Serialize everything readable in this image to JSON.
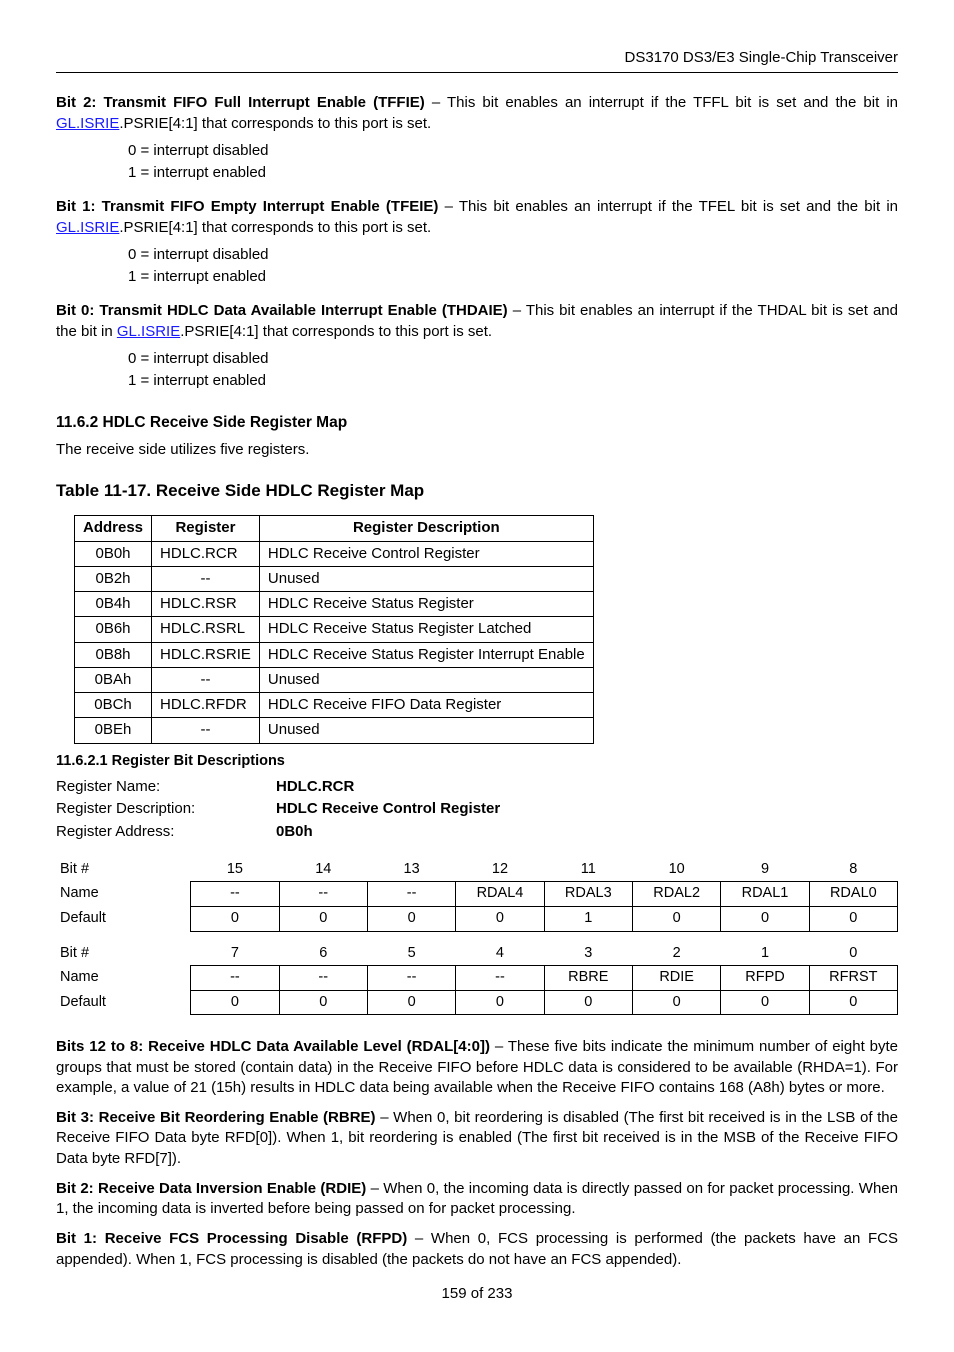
{
  "header": "DS3170 DS3/E3 Single-Chip Transceiver",
  "bit2": {
    "title": "Bit 2: Transmit FIFO Full Interrupt Enable (TFFIE)",
    "pre": " – This bit enables an interrupt if the TFFL bit is set and the bit in ",
    "link": "GL.ISRIE",
    "post": ".PSRIE[4:1] that corresponds to this port is set.",
    "l0": "0 = interrupt disabled",
    "l1": "1 = interrupt enabled"
  },
  "bit1": {
    "title": "Bit 1: Transmit FIFO Empty Interrupt Enable (TFEIE)",
    "pre": " – This bit enables an interrupt if the TFEL bit is set and the bit in ",
    "link": "GL.ISRIE",
    "post": ".PSRIE[4:1] that corresponds to this port is set.",
    "l0": "0 = interrupt disabled",
    "l1": "1 = interrupt enabled"
  },
  "bit0": {
    "title": "Bit 0: Transmit HDLC Data Available Interrupt Enable (THDAIE)",
    "pre": " – This bit enables an interrupt if the THDAL bit is set and the bit in ",
    "link": "GL.ISRIE",
    "post": ".PSRIE[4:1] that corresponds to this port is set.",
    "l0": "0 = interrupt disabled",
    "l1": "1 = interrupt enabled"
  },
  "section_1162": "11.6.2  HDLC Receive Side Register Map",
  "section_body": "The receive side utilizes five registers.",
  "table_title": "Table 11-17. Receive Side HDLC Register Map",
  "maphdr": {
    "a": "Address",
    "r": "Register",
    "d": "Register Description"
  },
  "rows": [
    {
      "a": "0B0h",
      "r": "HDLC.RCR",
      "d": "HDLC Receive Control Register"
    },
    {
      "a": "0B2h",
      "r": "--",
      "d": "Unused"
    },
    {
      "a": "0B4h",
      "r": "HDLC.RSR",
      "d": "HDLC Receive Status Register"
    },
    {
      "a": "0B6h",
      "r": "HDLC.RSRL",
      "d": "HDLC Receive Status Register Latched"
    },
    {
      "a": "0B8h",
      "r": "HDLC.RSRIE",
      "d": "HDLC Receive Status Register Interrupt Enable"
    },
    {
      "a": "0BAh",
      "r": "--",
      "d": "Unused"
    },
    {
      "a": "0BCh",
      "r": "HDLC.RFDR",
      "d": "HDLC Receive FIFO Data Register"
    },
    {
      "a": "0BEh",
      "r": "--",
      "d": "Unused"
    }
  ],
  "subsec": "11.6.2.1   Register Bit Descriptions",
  "reg": {
    "l1": "Register Name:",
    "v1": "HDLC.RCR",
    "l2": "Register Description:",
    "v2": "HDLC Receive Control Register",
    "l3": "Register Address:",
    "v3": "0B0h"
  },
  "bits": {
    "rowBit": "Bit #",
    "rowName": "Name",
    "rowDef": "Default",
    "hi": {
      "n": [
        "15",
        "14",
        "13",
        "12",
        "11",
        "10",
        "9",
        "8"
      ],
      "m": [
        "--",
        "--",
        "--",
        "RDAL4",
        "RDAL3",
        "RDAL2",
        "RDAL1",
        "RDAL0"
      ],
      "d": [
        "0",
        "0",
        "0",
        "0",
        "1",
        "0",
        "0",
        "0"
      ]
    },
    "lo": {
      "n": [
        "7",
        "6",
        "5",
        "4",
        "3",
        "2",
        "1",
        "0"
      ],
      "m": [
        "--",
        "--",
        "--",
        "--",
        "RBRE",
        "RDIE",
        "RFPD",
        "RFRST"
      ],
      "d": [
        "0",
        "0",
        "0",
        "0",
        "0",
        "0",
        "0",
        "0"
      ]
    }
  },
  "d12": {
    "t": "Bits 12 to 8: Receive HDLC Data Available Level (RDAL[4:0])",
    "b": " – These five bits indicate the minimum number of eight byte groups that must be stored (contain data) in the Receive FIFO before HDLC data is considered to be available (RHDA=1). For example, a value of 21 (15h) results in HDLC data being available when the Receive FIFO contains 168 (A8h) bytes or more."
  },
  "d3": {
    "t": "Bit 3: Receive Bit Reordering Enable (RBRE)",
    "b": " – When 0, bit reordering is disabled (The first bit received is in the LSB of the Receive FIFO Data byte RFD[0]). When 1, bit reordering is enabled (The first bit received is in the MSB of the Receive FIFO Data byte RFD[7])."
  },
  "d2": {
    "t": "Bit 2: Receive Data Inversion Enable (RDIE)",
    "b": " – When 0, the incoming data is directly passed on for packet processing. When 1, the incoming data is inverted before being passed on for packet processing."
  },
  "d1": {
    "t": "Bit 1: Receive FCS Processing Disable (RFPD)",
    "b": " – When 0, FCS processing is performed (the packets have an FCS appended). When 1, FCS processing is disabled (the packets do not have an FCS appended)."
  },
  "footer": "159 of 233"
}
